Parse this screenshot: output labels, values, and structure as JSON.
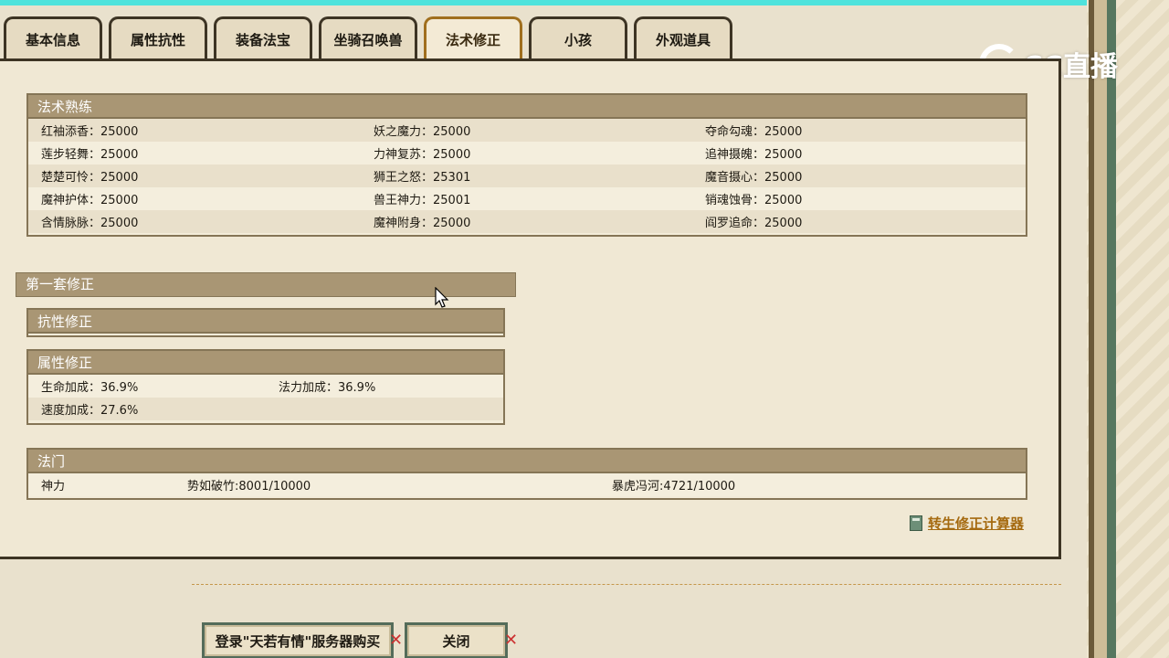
{
  "tabs": [
    {
      "label": "基本信息",
      "active": false
    },
    {
      "label": "属性抗性",
      "active": false
    },
    {
      "label": "装备法宝",
      "active": false
    },
    {
      "label": "坐骑召唤兽",
      "active": false
    },
    {
      "label": "法术修正",
      "active": true
    },
    {
      "label": "小孩",
      "active": false
    },
    {
      "label": "外观道具",
      "active": false
    }
  ],
  "spell_proficiency": {
    "title": "法术熟练",
    "rows": [
      [
        "红袖添香：25000",
        "妖之魔力：25000",
        "夺命勾魂：25000"
      ],
      [
        "莲步轻舞：25000",
        "力神复苏：25000",
        "追神摄魄：25000"
      ],
      [
        "楚楚可怜：25000",
        "狮王之怒：25301",
        "魔音摄心：25000"
      ],
      [
        "魔神护体：25000",
        "兽王神力：25001",
        "销魂蚀骨：25000"
      ],
      [
        "含情脉脉：25000",
        "魔神附身：25000",
        "阎罗追命：25000"
      ]
    ]
  },
  "set1": {
    "title": "第一套修正",
    "resist": {
      "title": "抗性修正"
    },
    "attr": {
      "title": "属性修正",
      "rows": [
        [
          "生命加成：36.9%",
          "法力加成：36.9%"
        ],
        [
          "速度加成：27.6%",
          ""
        ]
      ]
    }
  },
  "school": {
    "title": "法门",
    "cells": [
      "神力",
      "势如破竹:8001/10000",
      "暴虎冯河:4721/10000"
    ]
  },
  "calc_link": "转生修正计算器",
  "buttons": {
    "buy": "登录\"天若有情\"服务器购买",
    "close": "关闭"
  },
  "watermark": "CC直播",
  "colors": {
    "accent": "#a99674",
    "active_tab": "#a06f1e",
    "link": "#a56a10"
  }
}
